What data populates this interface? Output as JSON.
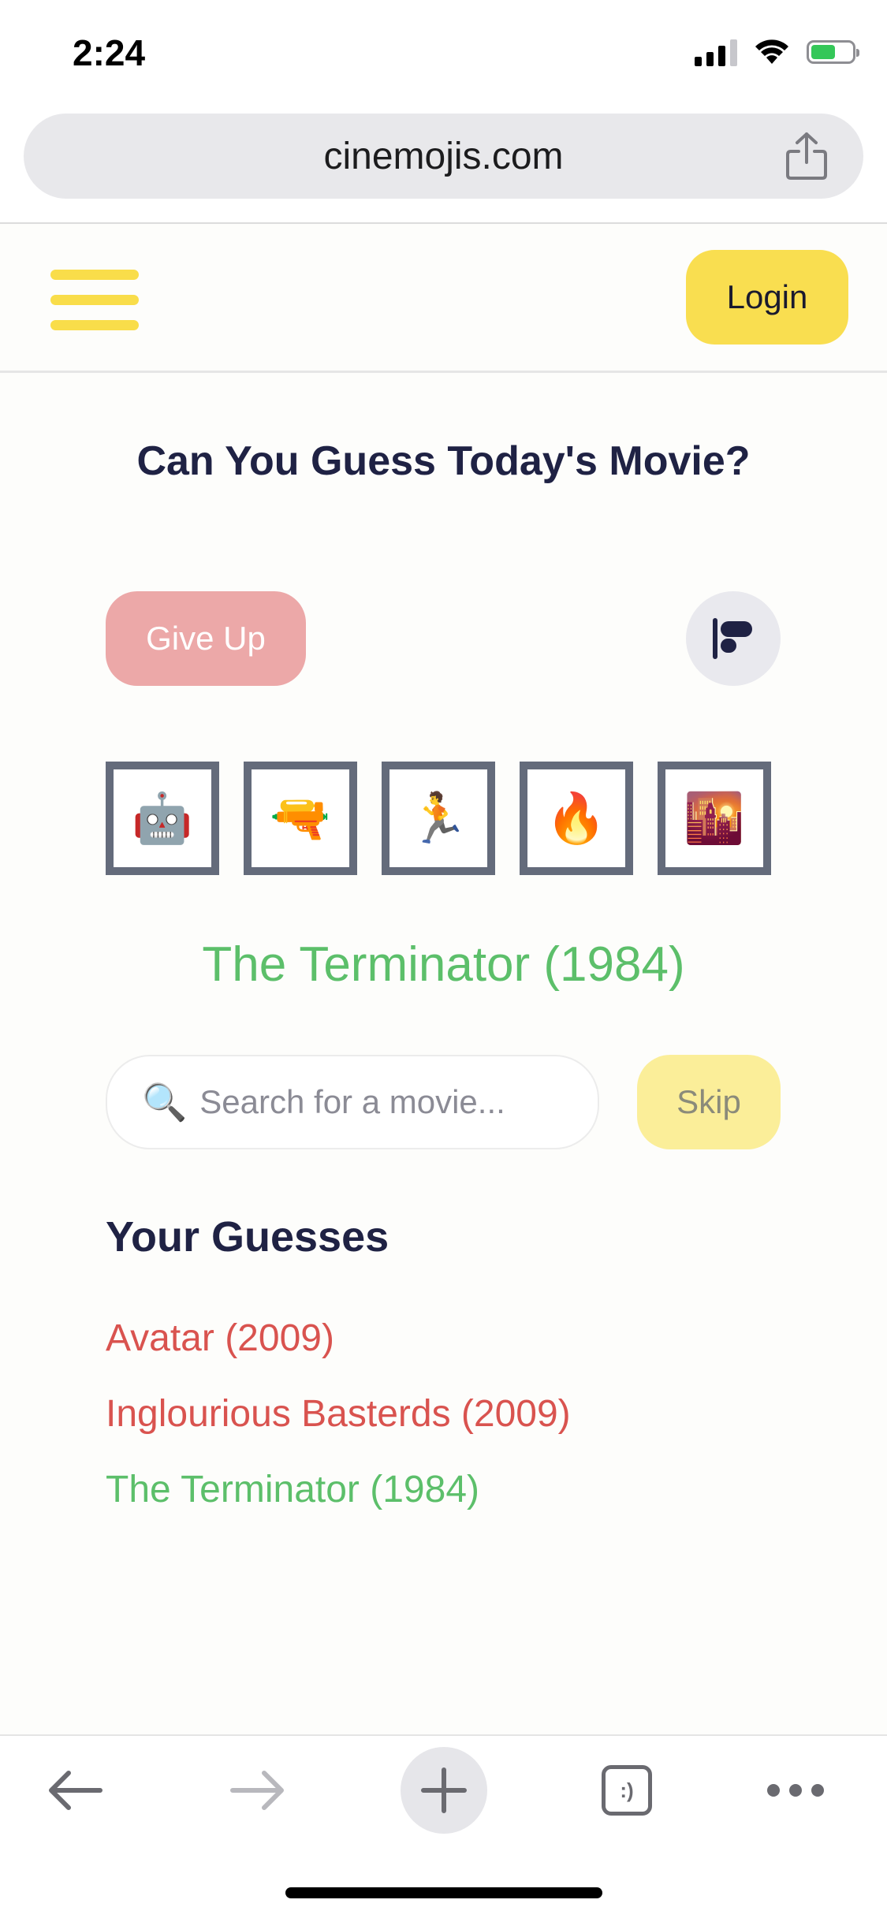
{
  "status": {
    "time": "2:24"
  },
  "browser": {
    "url": "cinemojis.com"
  },
  "header": {
    "login_label": "Login"
  },
  "main": {
    "title": "Can You Guess Today's Movie?",
    "give_up_label": "Give Up",
    "emojis": [
      "🤖",
      "🔫",
      "🏃",
      "🔥",
      "🌇"
    ],
    "answer": "The Terminator (1984)",
    "search_placeholder": "Search for a movie...",
    "skip_label": "Skip"
  },
  "guesses": {
    "heading": "Your Guesses",
    "items": [
      {
        "title": "Avatar (2009)",
        "correct": false
      },
      {
        "title": "Inglourious Basterds (2009)",
        "correct": false
      },
      {
        "title": "The Terminator (1984)",
        "correct": true
      }
    ]
  },
  "toolbar": {
    "tabs_glyph": ":)"
  },
  "colors": {
    "accent_yellow": "#f9de50",
    "correct_green": "#5cbf6a",
    "wrong_red": "#d9534f",
    "giveup_pink": "#eca8a8"
  }
}
